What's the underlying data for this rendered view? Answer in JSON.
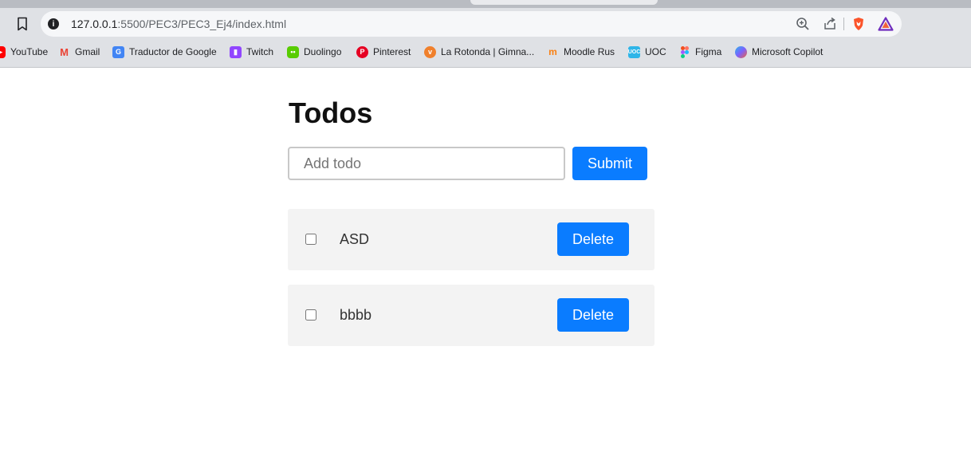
{
  "browser": {
    "url_host": "127.0.0.1",
    "url_rest": ":5500/PEC3/PEC3_Ej4/index.html",
    "bookmarks": [
      {
        "label": "YouTube",
        "icon": "youtube-icon",
        "color": "#ff0000"
      },
      {
        "label": "Gmail",
        "icon": "gmail-icon",
        "color": "#ea4335"
      },
      {
        "label": "Traductor de Google",
        "icon": "google-translate-icon",
        "color": "#4285f4"
      },
      {
        "label": "Twitch",
        "icon": "twitch-icon",
        "color": "#9146ff"
      },
      {
        "label": "Duolingo",
        "icon": "duolingo-icon",
        "color": "#58cc02"
      },
      {
        "label": "Pinterest",
        "icon": "pinterest-icon",
        "color": "#e60023"
      },
      {
        "label": "La Rotonda | Gimna...",
        "icon": "la-rotonda-icon",
        "color": "#f0802c"
      },
      {
        "label": "Moodle Rus",
        "icon": "moodle-icon",
        "color": "#f98012"
      },
      {
        "label": "UOC",
        "icon": "uoc-icon",
        "color": "#2fb5e8"
      },
      {
        "label": "Figma",
        "icon": "figma-icon",
        "color": "#f24e1e"
      },
      {
        "label": "Microsoft Copilot",
        "icon": "copilot-icon",
        "color": "#7b61ff"
      }
    ]
  },
  "app": {
    "title": "Todos",
    "input_placeholder": "Add todo",
    "input_value": "",
    "submit_label": "Submit",
    "accent_color": "#0a7cff",
    "todos": [
      {
        "text": "ASD",
        "done": false,
        "delete_label": "Delete"
      },
      {
        "text": "bbbb",
        "done": false,
        "delete_label": "Delete"
      }
    ]
  }
}
